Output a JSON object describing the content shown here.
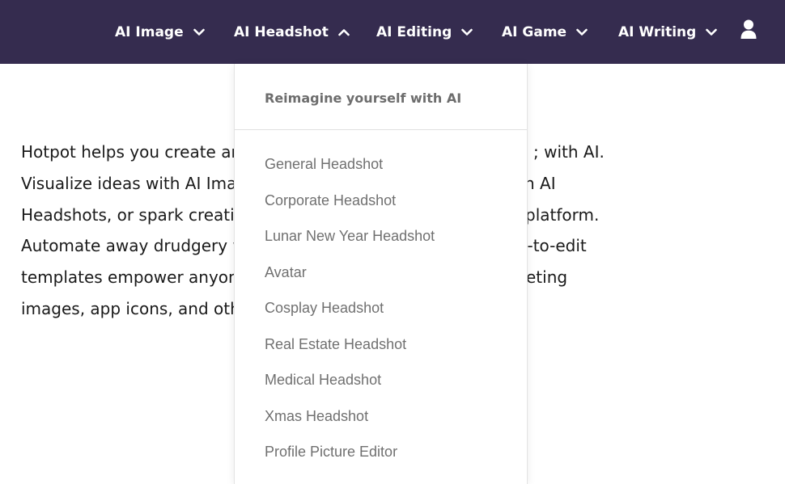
{
  "nav": {
    "items": [
      {
        "label": "AI Image",
        "expanded": false
      },
      {
        "label": "AI Headshot",
        "expanded": true
      },
      {
        "label": "AI Editing",
        "expanded": false
      },
      {
        "label": "AI Game",
        "expanded": false
      },
      {
        "label": "AI Writing",
        "expanded": false
      }
    ],
    "user_icon": "user-icon",
    "chevron_icon_down": "chevron-down-icon",
    "chevron_icon_up": "chevron-up-icon"
  },
  "colors": {
    "navbar_bg": "#352c4f",
    "nav_text": "#ffffff",
    "body_text": "#1a1a1a",
    "menu_text": "#707070"
  },
  "intro": {
    "lines": [
      "Hotpot helps you create ar",
      "Visualize ideas with AI Imag",
      "Headshots, or spark creativ",
      "Automate away drudgery w",
      "templates empower anyon",
      "images, app icons, and oth"
    ],
    "right_fragments": [
      "; with AI.",
      "h AI",
      "platform.",
      "y-to-edit",
      "eting",
      ""
    ]
  },
  "dropdown": {
    "heading": "Reimagine yourself with AI",
    "items": [
      "General Headshot",
      "Corporate Headshot",
      "Lunar New Year Headshot",
      "Avatar",
      "Cosplay Headshot",
      "Real Estate Headshot",
      "Medical Headshot",
      "Xmas Headshot",
      "Profile Picture Editor"
    ]
  }
}
